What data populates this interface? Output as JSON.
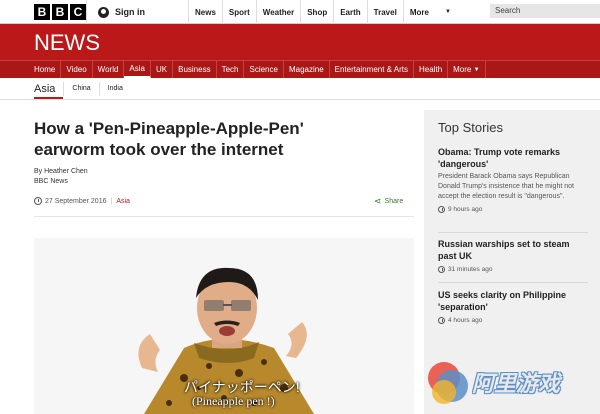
{
  "brand": {
    "logo_letters": [
      "B",
      "B",
      "C"
    ],
    "accent": "#bb1919"
  },
  "topbar": {
    "signin_label": "Sign in",
    "nav": [
      "News",
      "Sport",
      "Weather",
      "Shop",
      "Earth",
      "Travel",
      "More"
    ],
    "search_placeholder": "Search"
  },
  "header": {
    "title": "NEWS"
  },
  "rednav": [
    "Home",
    "Video",
    "World",
    "Asia",
    "UK",
    "Business",
    "Tech",
    "Science",
    "Magazine",
    "Entertainment & Arts",
    "Health",
    "More"
  ],
  "subnav": {
    "section": "Asia",
    "links": [
      "China",
      "India"
    ]
  },
  "article": {
    "headline": "How a 'Pen-Pineapple-Apple-Pen' earworm took over the internet",
    "author": "By Heather Chen",
    "source": "BBC News",
    "date": "27 September 2016",
    "category": "Asia",
    "share_label": "Share",
    "caption_jp": "パイナッポーペン!",
    "caption_en": "(Pineapple pen !)"
  },
  "sidebar": {
    "heading": "Top Stories",
    "stories": [
      {
        "title": "Obama: Trump vote remarks 'dangerous'",
        "summary": "President Barack Obama says Republican Donald Trump's insistence that he might not accept the election result is \"dangerous\".",
        "time": "9 hours ago"
      },
      {
        "title": "Russian warships set to steam past UK",
        "summary": "",
        "time": "31 minutes ago"
      },
      {
        "title": "US seeks clarity on Philippine 'separation'",
        "summary": "",
        "time": "4 hours ago"
      }
    ]
  },
  "watermark": {
    "text": "阿里游戏"
  }
}
